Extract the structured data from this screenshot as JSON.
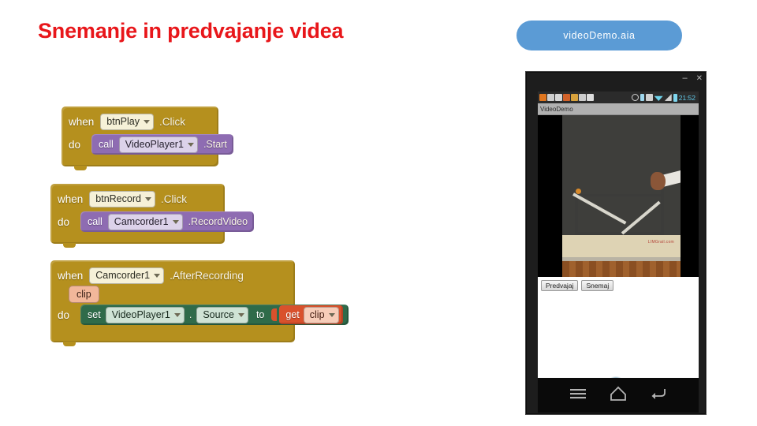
{
  "slide": {
    "title": "Snemanje in predvajanje videa",
    "title_color": "#e8161a",
    "background": "#ffffff"
  },
  "aia_link": {
    "label": "videoDemo.aia",
    "background": "#5b9bd5",
    "text_color": "#ffffff"
  },
  "blocks": [
    {
      "id": "block-play",
      "kind": "event",
      "color": "#b5901e",
      "when_label": "when",
      "component": "btnPlay",
      "event_suffix": ".Click",
      "do_label": "do",
      "statement": {
        "kind": "call",
        "color": "#8e6cb2",
        "verb": "call",
        "component": "VideoPlayer1",
        "method_suffix": ".Start"
      }
    },
    {
      "id": "block-record",
      "kind": "event",
      "color": "#b5901e",
      "when_label": "when",
      "component": "btnRecord",
      "event_suffix": ".Click",
      "do_label": "do",
      "statement": {
        "kind": "call",
        "color": "#8e6cb2",
        "verb": "call",
        "component": "Camcorder1",
        "method_suffix": ".RecordVideo"
      }
    },
    {
      "id": "block-afterrecording",
      "kind": "event",
      "color": "#b5901e",
      "when_label": "when",
      "component": "Camcorder1",
      "event_suffix": ".AfterRecording",
      "parameter": "clip",
      "do_label": "do",
      "statement": {
        "kind": "set",
        "color": "#2f6b4a",
        "verb": "set",
        "component": "VideoPlayer1",
        "dot": ".",
        "property": "Source",
        "to_label": "to",
        "value": {
          "kind": "get",
          "color": "#d9512c",
          "verb": "get",
          "variable": "clip"
        }
      }
    }
  ],
  "phone": {
    "window_controls": {
      "minimize": "–",
      "close": "✕"
    },
    "status_bar": {
      "clock": "21:52",
      "left_icons": [
        "notification-icon",
        "search-icon",
        "download-icon",
        "app-icon",
        "folder-icon",
        "mail-icon",
        "camera-icon"
      ],
      "right_icons": [
        "sync-icon",
        "bluetooth-icon",
        "sd-card-icon",
        "wifi-icon",
        "signal-icon",
        "battery-icon"
      ]
    },
    "app_title": "VideoDemo",
    "video": {
      "caption": "LIMGrail.com"
    },
    "buttons": [
      {
        "id": "play-button",
        "label": "Predvajaj"
      },
      {
        "id": "record-button",
        "label": "Snemaj"
      }
    ],
    "nav_bar": {
      "menu": "menu-icon",
      "home": "home-icon",
      "back": "back-icon"
    }
  }
}
